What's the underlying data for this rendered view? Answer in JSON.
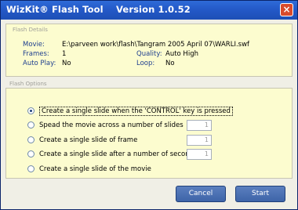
{
  "window": {
    "title": "WizKit® Flash Tool    Version 1.0.52",
    "close_glyph": "×"
  },
  "flash_details": {
    "legend": "Flash Details",
    "movie_label": "Movie:",
    "movie_value": "E:\\parveen work\\flash\\Tangram 2005 April 07\\WARLI.swf",
    "frames_label": "Frames:",
    "frames_value": "1",
    "quality_label": "Quality:",
    "quality_value": "Auto High",
    "autoplay_label": "Auto Play:",
    "autoplay_value": "No",
    "loop_label": "Loop:",
    "loop_value": "No"
  },
  "flash_options": {
    "legend": "Flash Options",
    "options": [
      {
        "label": "Create a single slide when the 'CONTROL' key is pressed",
        "selected": true
      },
      {
        "label": "Spead the movie across a number of slides",
        "selected": false,
        "value": "1"
      },
      {
        "label": "Create a single slide of frame",
        "selected": false,
        "value": "1"
      },
      {
        "label": "Create a single slide after a number of seconds",
        "selected": false,
        "value": "1"
      },
      {
        "label": "Create a single slide of the movie",
        "selected": false
      }
    ]
  },
  "buttons": {
    "cancel": "Cancel",
    "start": "Start"
  }
}
